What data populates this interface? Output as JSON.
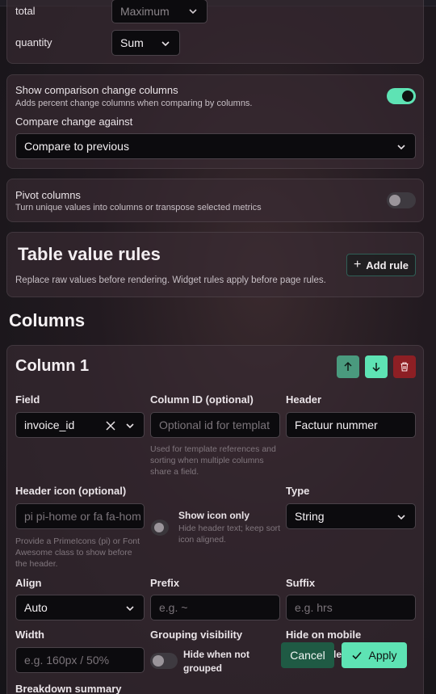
{
  "top_fields": {
    "total_label": "total",
    "total_value": "Maximum",
    "quantity_label": "quantity",
    "quantity_value": "Sum"
  },
  "comparison": {
    "title": "Show comparison change columns",
    "description": "Adds percent change columns when comparing by columns.",
    "enabled": true,
    "against_label": "Compare change against",
    "against_value": "Compare to previous"
  },
  "pivot": {
    "title": "Pivot columns",
    "description": "Turn unique values into columns or transpose selected metrics",
    "enabled": false
  },
  "value_rules": {
    "title": "Table value rules",
    "description": "Replace raw values before rendering. Widget rules apply before page rules.",
    "add_button": "Add rule"
  },
  "columns_heading": "Columns",
  "column": {
    "title": "Column 1",
    "field_label": "Field",
    "field_value": "invoice_id",
    "column_id_label": "Column ID (optional)",
    "column_id_placeholder": "Optional id for templat",
    "column_id_hint": "Used for template references and sorting when multiple columns share a field.",
    "header_label": "Header",
    "header_value": "Factuur nummer",
    "header_icon_label": "Header icon (optional)",
    "header_icon_placeholder": "pi pi-home or fa fa-hom",
    "header_icon_hint": "Provide a PrimeIcons (pi) or Font Awesome class to show before the header.",
    "show_icon_only_label": "Show icon only",
    "show_icon_only_hint": "Hide header text; keep sort icon aligned.",
    "show_icon_only_enabled": false,
    "type_label": "Type",
    "type_value": "String",
    "align_label": "Align",
    "align_value": "Auto",
    "prefix_label": "Prefix",
    "prefix_placeholder": "e.g. ~",
    "suffix_label": "Suffix",
    "suffix_placeholder": "e.g. hrs",
    "width_label": "Width",
    "width_placeholder": "e.g. 160px / 50%",
    "grouping_label": "Grouping visibility",
    "grouping_toggle_label": "Hide when not grouped",
    "grouping_enabled": false,
    "hide_mobile_label": "Hide on mobile",
    "hide_mobile_partial": "le",
    "breakdown_label": "Breakdown summary"
  },
  "actions": {
    "cancel": "Cancel",
    "apply": "Apply"
  },
  "colors": {
    "accent": "#5ee3b4",
    "move_up": "#4a9a7e",
    "delete": "#8d1f24"
  }
}
